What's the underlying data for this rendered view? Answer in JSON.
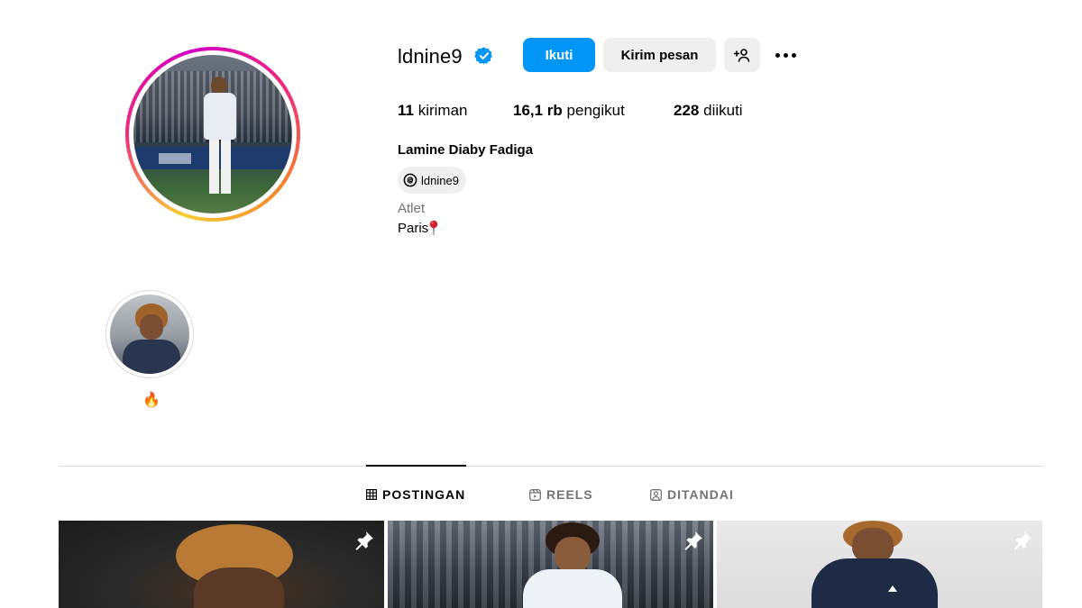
{
  "profile": {
    "username": "ldnine9",
    "verified_icon": "verified-badge-icon",
    "full_name": "Lamine Diaby Fadiga",
    "threads_handle": "ldnine9",
    "category": "Atlet",
    "bio_location": "Paris",
    "bio_icon": "round-pushpin-icon"
  },
  "actions": {
    "follow_label": "Ikuti",
    "message_label": "Kirim pesan",
    "suggest_icon": "add-user-icon",
    "more_icon": "more-options-icon"
  },
  "stats": {
    "posts_count": "11",
    "posts_label": "kiriman",
    "followers_count": "16,1 rb",
    "followers_label": "pengikut",
    "following_count": "228",
    "following_label": "diikuti"
  },
  "highlights": [
    {
      "label": "🔥"
    }
  ],
  "tabs": [
    {
      "label": "POSTINGAN",
      "icon": "grid-icon",
      "active": true
    },
    {
      "label": "REELS",
      "icon": "reels-icon",
      "active": false
    },
    {
      "label": "DITANDAI",
      "icon": "tagged-icon",
      "active": false
    }
  ],
  "posts": [
    {
      "pinned": true,
      "pin_icon": "pin-icon"
    },
    {
      "pinned": true,
      "pin_icon": "pin-icon"
    },
    {
      "pinned": true,
      "pin_icon": "pin-icon"
    }
  ],
  "colors": {
    "accent": "#0095f6",
    "secondary_button": "#efefef",
    "muted_text": "#737373",
    "divider": "#dbdbdb"
  }
}
